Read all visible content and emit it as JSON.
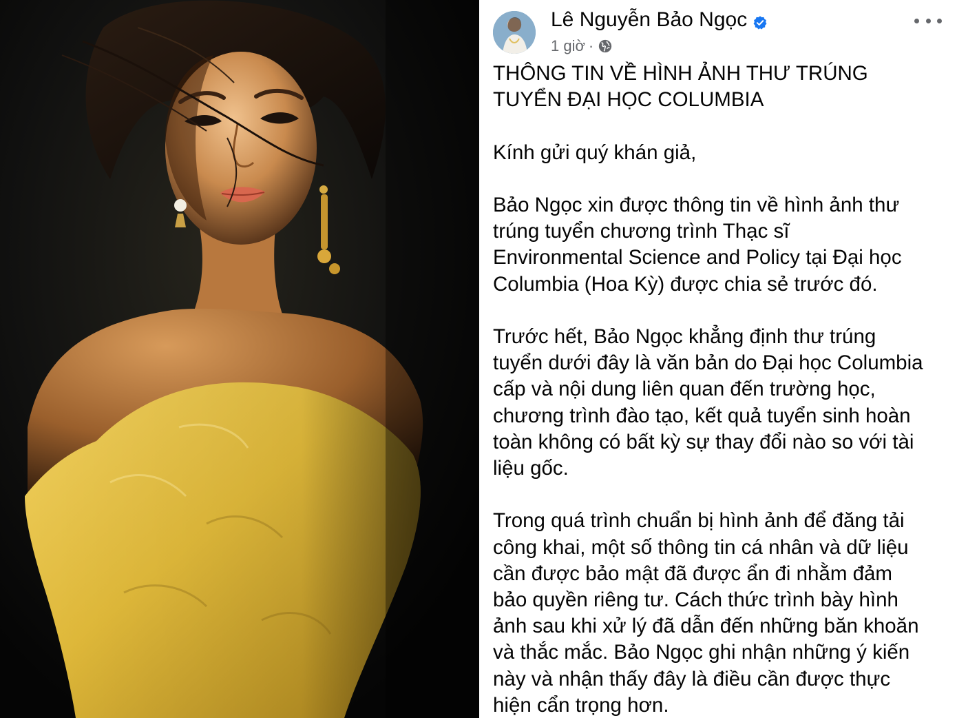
{
  "post": {
    "author_name": "Lê Nguyễn Bảo Ngọc",
    "time": "1 giờ",
    "separator": "·",
    "icons": {
      "verified": "verified-badge-icon",
      "audience": "globe-icon",
      "more": "more-options-icon"
    },
    "colors": {
      "verified": "#1877f2",
      "meta_text": "#65676b",
      "body_text": "#050505"
    },
    "headline_lines": [
      "THÔNG TIN VỀ HÌNH ẢNH THƯ TRÚNG",
      "TUYỂN ĐẠI HỌC COLUMBIA"
    ],
    "greeting": "Kính gửi quý khán giả,",
    "paragraph_1": [
      "Bảo Ngọc xin được thông tin về hình ảnh thư",
      "trúng tuyển chương trình Thạc sĩ",
      "Environmental Science and Policy tại Đại học",
      "Columbia (Hoa Kỳ) được chia sẻ trước đó."
    ],
    "paragraph_2": [
      "Trước hết, Bảo Ngọc khẳng định thư trúng",
      "tuyển dưới đây là văn bản do Đại học Columbia",
      "cấp và nội dung liên quan đến trường học,",
      "chương trình đào tạo, kết quả tuyển sinh hoàn",
      "toàn không có bất kỳ sự thay đổi nào so với tài",
      "liệu gốc."
    ],
    "paragraph_3": [
      "Trong quá trình chuẩn bị hình ảnh để đăng tải",
      "công khai, một số thông tin cá nhân và dữ liệu",
      "cần được bảo mật đã được ẩn đi nhằm đảm",
      "bảo quyền riêng tư. Cách thức trình bày hình",
      "ảnh sau khi xử lý đã dẫn đến những băn khoăn",
      "và thắc mắc. Bảo Ngọc ghi nhận những ý kiến",
      "này và nhận thấy đây là điều cần được thực",
      "hiện cẩn trọng hơn."
    ]
  }
}
